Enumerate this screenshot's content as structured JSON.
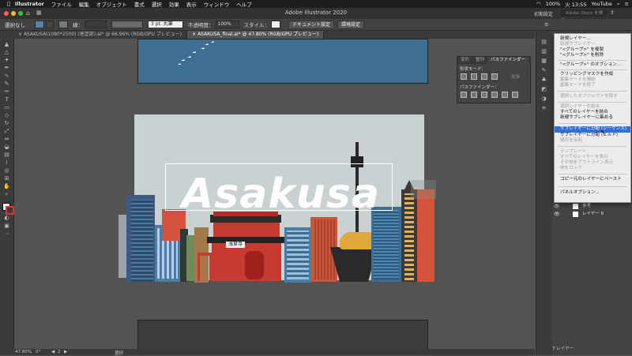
{
  "menubar": {
    "app": "Illustrator",
    "items": [
      "ファイル",
      "編集",
      "オブジェクト",
      "書式",
      "選択",
      "効果",
      "表示",
      "ウィンドウ",
      "ヘルプ"
    ],
    "right": {
      "battery": "100%",
      "clock": "火 13:55",
      "user": "YouTube"
    }
  },
  "appbar": {
    "title": "Adobe Illustrator 2020",
    "workspace": "初期設定",
    "search_placeholder": "Adobe Stock を検索"
  },
  "control": {
    "selection": "選択なし",
    "stroke_label": "線：",
    "stroke_style": "3 pt. 丸筆",
    "opacity_label": "不透明度：",
    "opacity": "100%",
    "style_label": "スタイル：",
    "doc_setup": "ドキュメント設定",
    "prefs": "環境設定"
  },
  "tabs": [
    {
      "label": "ASAKUSA(1080*2500) (地塗部).ai* @ 66.96% (RGB/GPU プレビュー)",
      "active": false
    },
    {
      "label": "ASAKUSA_final.ai* @ 47.80% (RGB/GPU プレビュー)",
      "active": true
    }
  ],
  "artwork": {
    "title": "Asakusa",
    "sign": "浅草寺"
  },
  "pathfinder": {
    "tabs": [
      "変形",
      "整列",
      "パスファインダー"
    ],
    "shape_modes": "形状モード：",
    "expand": "拡張",
    "pathfinders": "パスファインダー："
  },
  "layers": [
    {
      "name": "参考"
    },
    {
      "name": "レイヤー 6"
    }
  ],
  "layers_footer": "7 レイヤー",
  "menu": [
    {
      "label": "新規レイヤー...",
      "state": "normal"
    },
    {
      "label": "新規サブレイヤー...",
      "state": "disabled"
    },
    {
      "label": "\"<グループ>\" を複製",
      "state": "normal"
    },
    {
      "label": "\"<グループ>\" を削除",
      "state": "normal"
    },
    {
      "sep": true
    },
    {
      "label": "\"<グループ>\" のオプション...",
      "state": "normal"
    },
    {
      "sep": true
    },
    {
      "label": "クリッピングマスクを作成",
      "state": "normal"
    },
    {
      "label": "編集モードを開始",
      "state": "disabled"
    },
    {
      "label": "編集モードを終了",
      "state": "disabled"
    },
    {
      "sep": true
    },
    {
      "label": "選択したオブジェクトを探す",
      "state": "disabled"
    },
    {
      "sep": true
    },
    {
      "label": "選択レイヤーを結合",
      "state": "disabled"
    },
    {
      "label": "すべてのレイヤーを結合",
      "state": "normal"
    },
    {
      "label": "新規サブレイヤーに集める",
      "state": "normal"
    },
    {
      "sep": true
    },
    {
      "label": "サブレイヤーに分配 (シーケンス)",
      "state": "selected"
    },
    {
      "label": "サブレイヤーに分配 (ビルド)",
      "state": "normal"
    },
    {
      "label": "順序を反転",
      "state": "disabled"
    },
    {
      "sep": true
    },
    {
      "label": "テンプレート",
      "state": "disabled"
    },
    {
      "label": "すべてのレイヤーを表示",
      "state": "disabled"
    },
    {
      "label": "その他をアウトライン表示",
      "state": "disabled"
    },
    {
      "label": "他をロック",
      "state": "disabled"
    },
    {
      "sep": true
    },
    {
      "label": "コピー元のレイヤーにペースト",
      "state": "normal"
    },
    {
      "sep": true
    },
    {
      "label": "パネルオプション...",
      "state": "normal"
    }
  ],
  "status": {
    "zoom": "47.80%",
    "angle": "0°",
    "page": "2",
    "mode": "選択"
  },
  "colors": {
    "sky": "#3f6e93",
    "accent": "#2f6fd6",
    "bg": "#535353"
  }
}
